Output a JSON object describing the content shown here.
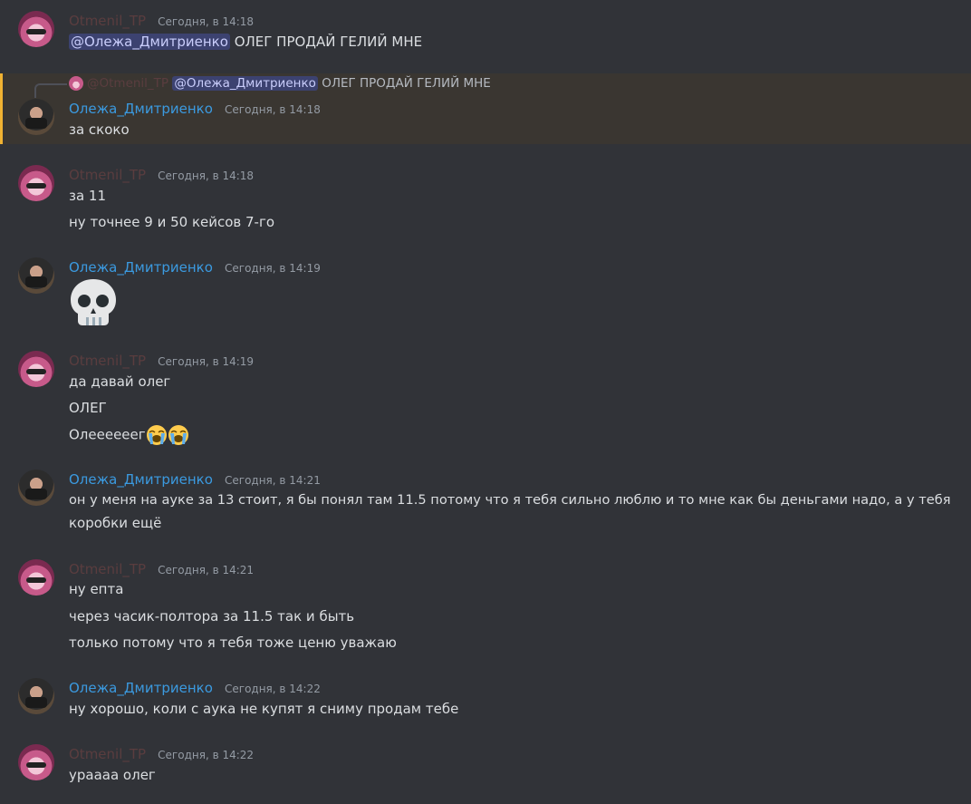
{
  "messages": {
    "m1": {
      "author": "Otmenil_TP",
      "time": "Сегодня, в 14:18",
      "mention": "@Олежа_Дмитриенко",
      "text": "ОЛЕГ ПРОДАЙ ГЕЛИЙ МНЕ"
    },
    "m2": {
      "reply": {
        "author": "@Otmenil_TP",
        "mention": "@Олежа_Дмитриенко",
        "text": "ОЛЕГ ПРОДАЙ ГЕЛИЙ МНЕ"
      },
      "author": "Олежа_Дмитриенко",
      "time": "Сегодня, в 14:18",
      "lines": [
        "за скоко"
      ]
    },
    "m3": {
      "author": "Otmenil_TP",
      "time": "Сегодня, в 14:18",
      "lines": [
        "за 11",
        "ну точнее 9 и 50 кейсов 7-го"
      ]
    },
    "m4": {
      "author": "Олежа_Дмитриенко",
      "time": "Сегодня, в 14:19",
      "emoji": "skull-emoji"
    },
    "m5": {
      "author": "Otmenil_TP",
      "time": "Сегодня, в 14:19",
      "lines": [
        "да давай олег",
        "ОЛЕГ",
        "Олеееееег"
      ]
    },
    "m6": {
      "author": "Олежа_Дмитриенко",
      "time": "Сегодня, в 14:21",
      "lines": [
        "он у меня на ауке за 13 стоит, я бы понял там 11.5 потому что я тебя сильно люблю и то мне как бы деньгами надо, а у тебя",
        "коробки ещё"
      ]
    },
    "m7": {
      "author": "Otmenil_TP",
      "time": "Сегодня, в 14:21",
      "lines": [
        "ну епта",
        "через часик-полтора за 11.5 так и быть",
        "только потому что я тебя тоже ценю уважаю"
      ]
    },
    "m8": {
      "author": "Олежа_Дмитриенко",
      "time": "Сегодня, в 14:22",
      "lines": [
        "ну хорошо, коли с аука не купят я сниму продам тебе"
      ]
    },
    "m9": {
      "author": "Otmenil_TP",
      "time": "Сегодня, в 14:22",
      "lines": [
        "ураааа олег"
      ]
    }
  },
  "colors": {
    "background": "#313338",
    "otmenil_name": "#5a3d3f",
    "oleg_name": "#3b9ae0",
    "highlight_bar": "#f0b232",
    "mention_bg": "#3c4270"
  }
}
